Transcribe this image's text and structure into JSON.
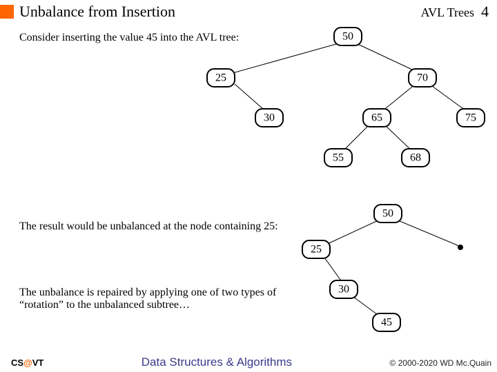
{
  "header": {
    "title": "Unbalance from Insertion",
    "topic": "AVL Trees",
    "page_number": "4"
  },
  "intro_text": "Consider inserting the value 45 into the AVL tree:",
  "result_text": "The result would be unbalanced at the node containing 25:",
  "repair_text": "The unbalance is repaired by applying one of two types of “rotation” to the unbalanced subtree…",
  "tree1": {
    "n50": "50",
    "n25": "25",
    "n70": "70",
    "n30": "30",
    "n65": "65",
    "n75": "75",
    "n55": "55",
    "n68": "68"
  },
  "tree2": {
    "n50": "50",
    "n25": "25",
    "n30": "30",
    "n45": "45"
  },
  "footer": {
    "left_cs": "CS",
    "left_at": "@",
    "left_vt": "VT",
    "center": "Data Structures & Algorithms",
    "right": "© 2000-2020 WD Mc.Quain"
  }
}
